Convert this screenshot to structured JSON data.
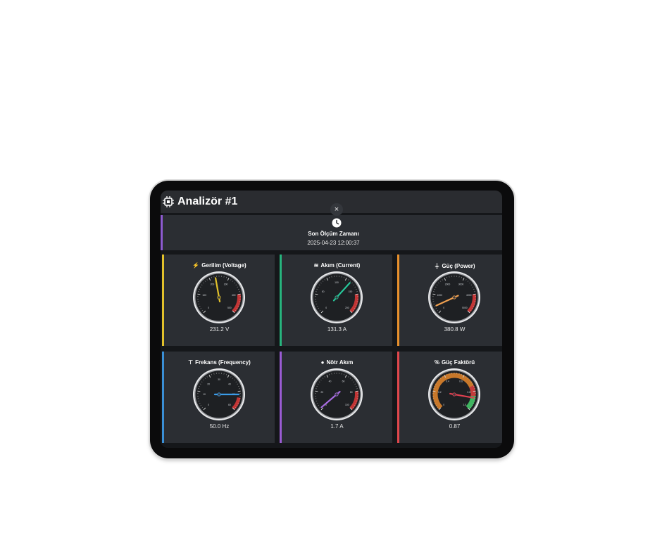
{
  "app": {
    "title": "Analizör #1",
    "close_icon": "×"
  },
  "last_measurement": {
    "label": "Son Ölçüm Zamanı",
    "value": "2025-04-23 12:00:37"
  },
  "gauges": [
    {
      "id": "voltage",
      "title": "Gerilim (Voltage)",
      "icon": "lightning-icon",
      "icon_glyph": "⚡",
      "accent": "#e2c12b",
      "value_text": "231.2 V",
      "value": 231.2,
      "min": 0,
      "max": 500,
      "ticks": [
        "0",
        "100",
        "200",
        "300",
        "400",
        "500"
      ],
      "needle": "#e2c12b",
      "red_from": 400,
      "style": "dark"
    },
    {
      "id": "current",
      "title": "Akım (Current)",
      "icon": "current-icon",
      "icon_glyph": "≋",
      "accent": "#27b57e",
      "value_text": "131.3 A",
      "value": 131.3,
      "min": 0,
      "max": 200,
      "ticks": [
        "0",
        "50",
        "100",
        "150",
        "200"
      ],
      "needle": "#27c79a",
      "red_from": 160,
      "style": "dark"
    },
    {
      "id": "power",
      "title": "Güç (Power)",
      "icon": "plug-icon",
      "icon_glyph": "⏚",
      "accent": "#e8902c",
      "value_text": "380.8 W",
      "value": 380.8,
      "min": 0,
      "max": 5000,
      "ticks": [
        "0",
        "1000",
        "2000",
        "3000",
        "4000",
        "5000"
      ],
      "needle": "#f0a050",
      "red_from": 4000,
      "style": "dark"
    },
    {
      "id": "frequency",
      "title": "Frekans (Frequency)",
      "icon": "antenna-icon",
      "icon_glyph": "⊤",
      "accent": "#3a8fd6",
      "value_text": "50.0 Hz",
      "value": 50.0,
      "min": 0,
      "max": 60,
      "ticks": [
        "0",
        "10",
        "20",
        "30",
        "40",
        "50",
        "60"
      ],
      "needle": "#3a9be8",
      "red_from": 52,
      "style": "dark"
    },
    {
      "id": "neutral",
      "title": "Nötr Akım",
      "icon": "drop-icon",
      "icon_glyph": "●",
      "accent": "#9b5cd4",
      "value_text": "1.7 A",
      "value": 1.7,
      "min": 0,
      "max": 100,
      "ticks": [
        "0",
        "20",
        "40",
        "60",
        "80",
        "100"
      ],
      "needle": "#a76be0",
      "red_from": 80,
      "style": "dark"
    },
    {
      "id": "power_factor",
      "title": "Güç Faktörü",
      "icon": "percent-icon",
      "icon_glyph": "%",
      "accent": "#e0474c",
      "value_text": "0.87",
      "value": 0.87,
      "min": 0,
      "max": 1,
      "ticks": [
        "0",
        "0.2",
        "0.4",
        "0.6",
        "0.8",
        "1.0"
      ],
      "needle": "#e04050",
      "red_from": 0.9,
      "style": "pf"
    }
  ]
}
